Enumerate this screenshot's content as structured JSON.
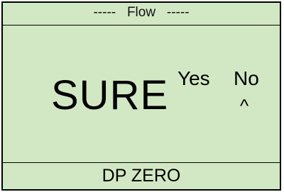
{
  "colors": {
    "screen_background": "#d2e8c4",
    "text": "#000000",
    "divider": "#000000"
  },
  "header": {
    "title": "-----   Flow   -----"
  },
  "main": {
    "prompt": "SURE",
    "options": [
      "Yes",
      "No"
    ],
    "cursor_symbol": "^",
    "selected_option": "No"
  },
  "footer": {
    "label": "DP ZERO"
  }
}
